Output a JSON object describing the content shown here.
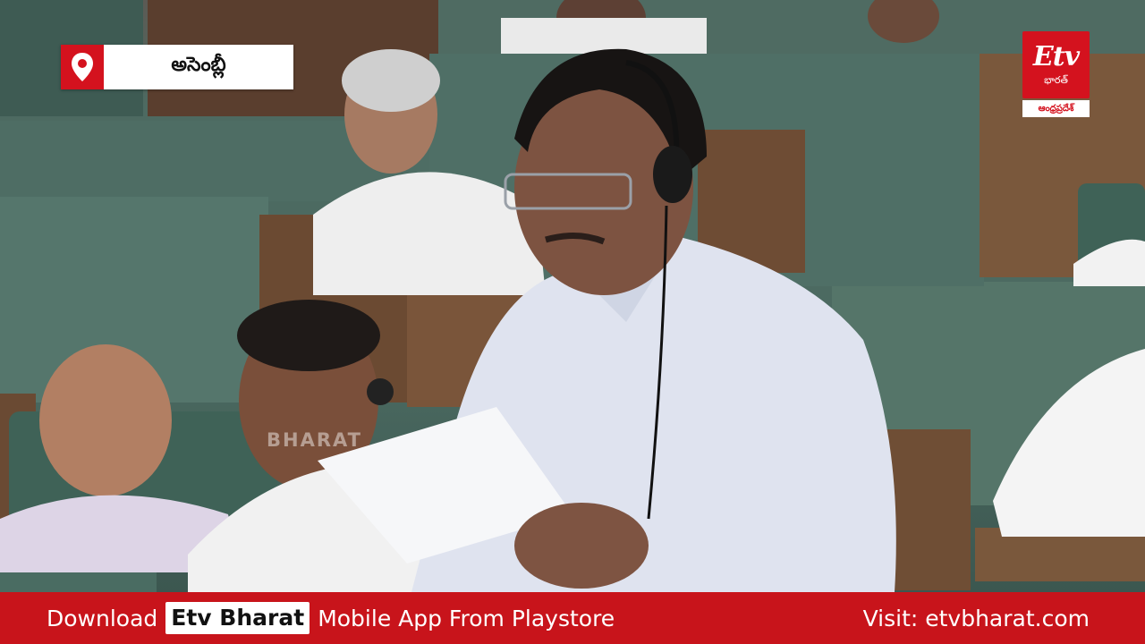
{
  "location": {
    "icon": "map-pin-icon",
    "label": "అసెంబ్లీ"
  },
  "channel_logo": {
    "mark": "Etv",
    "subtitle": "భారత్",
    "region": "ఆంధ్రప్రదేశ్"
  },
  "watermark": "BHARAT",
  "banner": {
    "download_word": "Download",
    "brand": "Etv Bharat",
    "rest": "Mobile App From Playstore",
    "visit": "Visit: etvbharat.com"
  },
  "colors": {
    "brand_red": "#d4121e",
    "banner_red": "#c8141b",
    "white": "#ffffff"
  }
}
